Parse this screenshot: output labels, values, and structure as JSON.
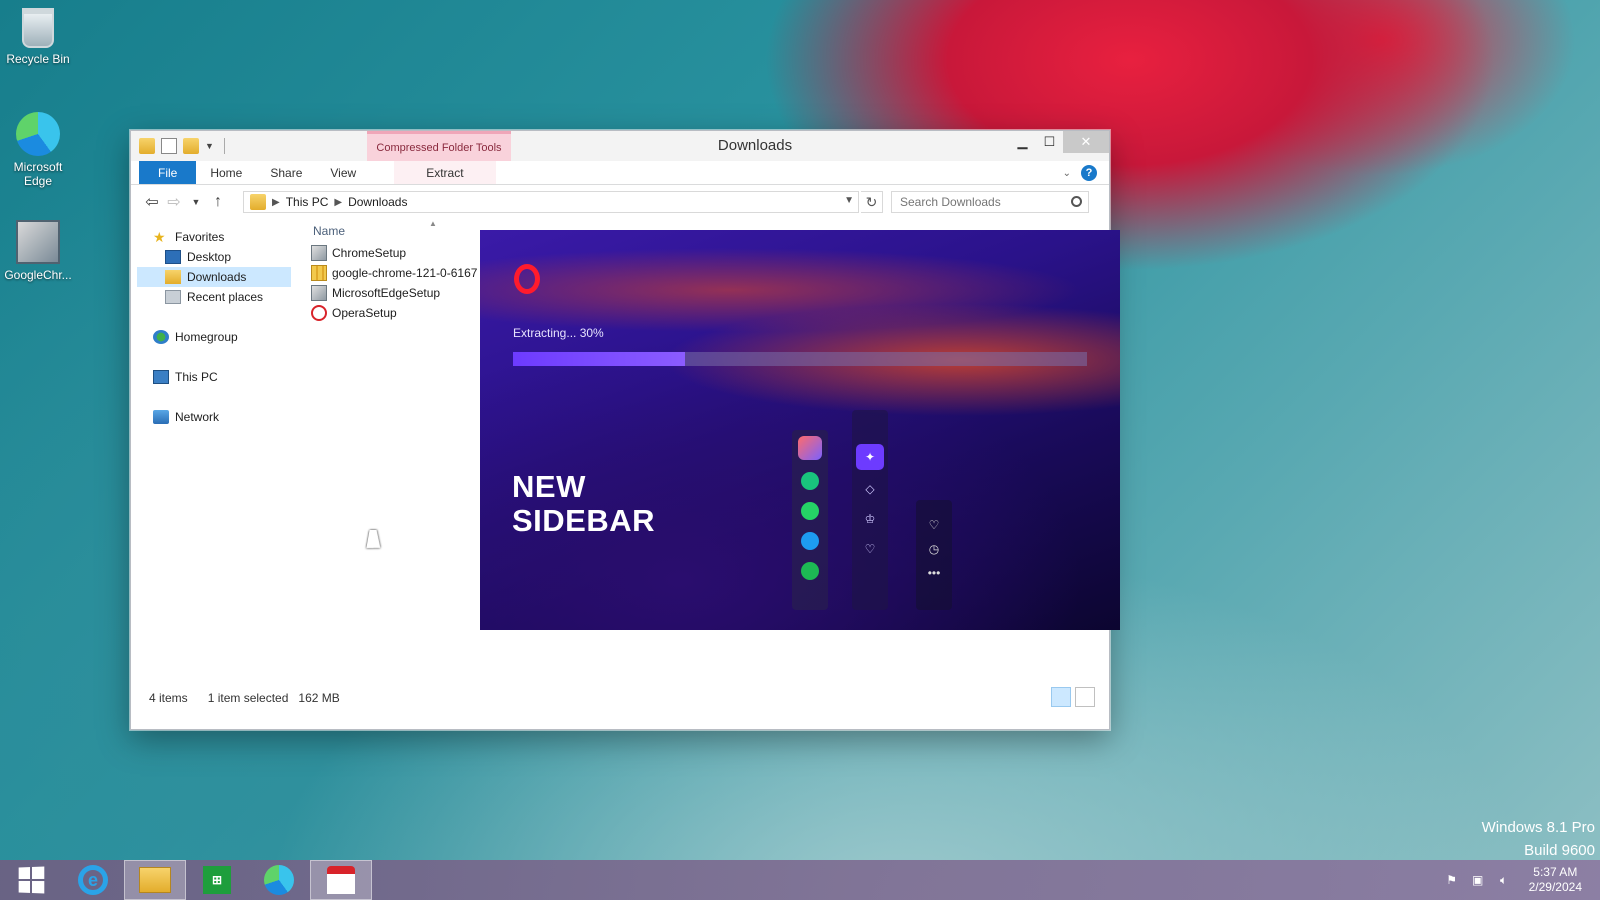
{
  "desktop": {
    "icons": [
      {
        "label": "Recycle Bin",
        "icon": "recycle-bin-icon"
      },
      {
        "label": "Microsoft Edge",
        "icon": "edge-icon"
      },
      {
        "label": "GoogleChr...",
        "icon": "setup-icon"
      }
    ],
    "watermark": {
      "line1": "Windows 8.1 Pro",
      "line2": "Build 9600"
    }
  },
  "explorer": {
    "title": "Downloads",
    "context_tab_header": "Compressed Folder Tools",
    "ribbon_tabs": {
      "file": "File",
      "home": "Home",
      "share": "Share",
      "view": "View",
      "extract": "Extract"
    },
    "breadcrumb": {
      "root": "This PC",
      "current": "Downloads"
    },
    "search_placeholder": "Search Downloads",
    "nav_pane": {
      "favorites": "Favorites",
      "desktop": "Desktop",
      "downloads": "Downloads",
      "recent": "Recent places",
      "homegroup": "Homegroup",
      "this_pc": "This PC",
      "network": "Network"
    },
    "column_name": "Name",
    "files": [
      {
        "name": "ChromeSetup",
        "icon": "setup-icon"
      },
      {
        "name": "google-chrome-121-0-6167",
        "icon": "zip-folder-icon"
      },
      {
        "name": "MicrosoftEdgeSetup",
        "icon": "setup-icon"
      },
      {
        "name": "OperaSetup",
        "icon": "opera-icon"
      }
    ],
    "status": {
      "items": "4 items",
      "selected": "1 item selected",
      "size": "162 MB"
    }
  },
  "installer": {
    "status_text": "Extracting... 30%",
    "progress": 0.3,
    "headline_line1": "NEW",
    "headline_line2": "SIDEBAR",
    "accent_color": "#6d3bff",
    "brand_color": "#ff1b2d"
  },
  "taskbar": {
    "clock_time": "5:37 AM",
    "clock_date": "2/29/2024"
  }
}
